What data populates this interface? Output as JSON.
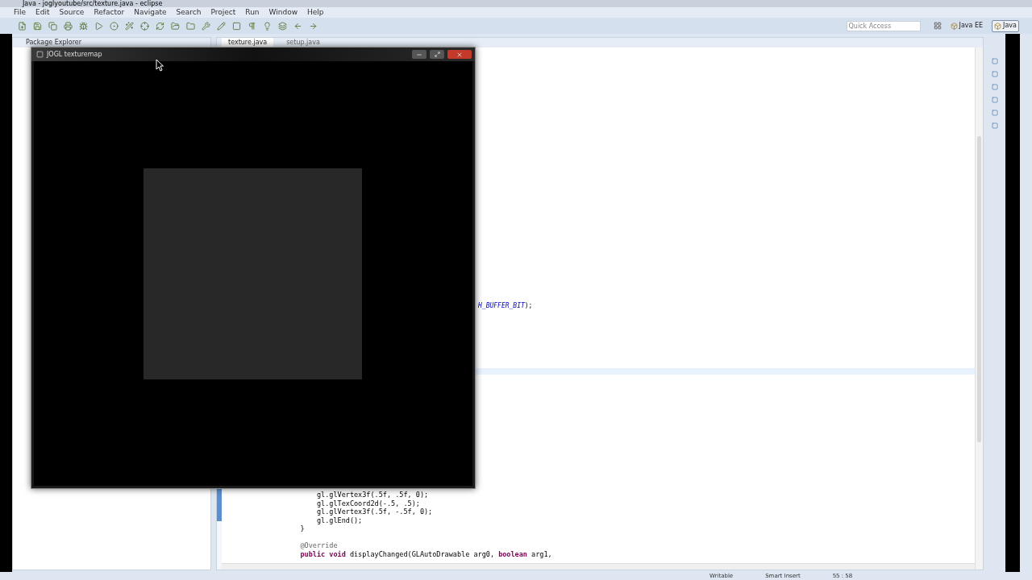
{
  "window": {
    "title": "Java - joglyoutube/src/texture.java - eclipse"
  },
  "menu": [
    "File",
    "Edit",
    "Source",
    "Refactor",
    "Navigate",
    "Search",
    "Project",
    "Run",
    "Window",
    "Help"
  ],
  "quick_access": {
    "placeholder": "Quick Access"
  },
  "perspectives": [
    {
      "label": "Java EE",
      "selected": false
    },
    {
      "label": "Java",
      "selected": true
    }
  ],
  "package_explorer": {
    "title": "Package Explorer"
  },
  "editor": {
    "tabs": [
      {
        "label": "texture.java",
        "selected": true
      },
      {
        "label": "setup.java",
        "selected": false
      }
    ],
    "partial_line": [
      {
        "text": "H_BUFFER_BIT",
        "kind": "constant"
      },
      {
        "text": ");",
        "kind": "plain"
      }
    ],
    "lines": [
      [
        {
          "text": "        gl.glVertex3f(.5f, .5f, 0);",
          "kind": "plain"
        }
      ],
      [
        {
          "text": "        gl.glTexCoord2d(-.5, .5);",
          "kind": "plain"
        }
      ],
      [
        {
          "text": "        gl.glVertex3f(.5f, -.5f, 0);",
          "kind": "plain"
        }
      ],
      [
        {
          "text": "        gl.glEnd();",
          "kind": "plain"
        }
      ],
      [
        {
          "text": "    }",
          "kind": "plain"
        }
      ],
      [
        {
          "text": "    @Override",
          "kind": "annotation"
        }
      ],
      [
        {
          "text": "    public void",
          "kind": "keyword"
        },
        {
          "text": " displayChanged(GLAutoDrawable arg0, ",
          "kind": "plain"
        },
        {
          "text": "boolean",
          "kind": "keyword"
        },
        {
          "text": " arg1,",
          "kind": "plain"
        }
      ]
    ]
  },
  "jogl_window": {
    "title": "JOGL texturemap"
  },
  "status_bar": [
    "Writable",
    "Smart Insert",
    "55 : 58"
  ]
}
